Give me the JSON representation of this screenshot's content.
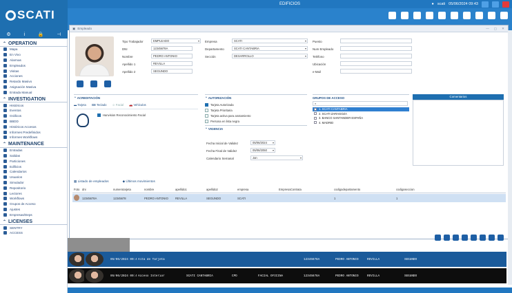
{
  "app": {
    "brand": "SCATI",
    "window_title": "EDIFICIOS",
    "status_user": "scati",
    "status_datetime": "05/06/2024 09:43"
  },
  "sidebar": {
    "sections": [
      {
        "title": "OPERATION",
        "items": [
          "Mapa",
          "En Vivo",
          "Alarmas",
          "Empleados",
          "Visitas",
          "Acciones",
          "Retardo Masivo",
          "Asignación Masiva",
          "Entrada Manual"
        ]
      },
      {
        "title": "INVESTIGATION",
        "items": [
          "Históricos",
          "Eventos",
          "Gráficos",
          "BBDD",
          "Históricos Accesos",
          "Informes Predefinidos",
          "Informes Workflows"
        ]
      },
      {
        "title": "MAINTENANCE",
        "items": [
          "Entradas",
          "Salidas",
          "Particiones",
          "Edificios",
          "Calendarios",
          "Usuarios",
          "Simulador",
          "Repositorio",
          "Lectores",
          "Workflows",
          "Grupos de Acceso",
          "Ajustes",
          "Empresas/Deps"
        ]
      },
      {
        "title": "LICENSES",
        "items": [
          "SENTRY",
          "ACCESS"
        ]
      }
    ]
  },
  "inner": {
    "title": "Empleado"
  },
  "form": {
    "tipo_trabajador": {
      "label": "Tipo Trabajador",
      "value": "EMPLEADO"
    },
    "dni": {
      "label": "DNI",
      "value": "12345678A"
    },
    "nombre": {
      "label": "Nombre",
      "value": "PEDRO ANTONIO"
    },
    "apellido1": {
      "label": "Apellido 1",
      "value": "REVILLA"
    },
    "apellido2": {
      "label": "Apellido 2",
      "value": "SEGUNDO"
    },
    "empresa": {
      "label": "Empresa",
      "value": "SCATI"
    },
    "departamento": {
      "label": "Departamento",
      "value": "SCATI CANTABRIA"
    },
    "seccion": {
      "label": "Sección",
      "value": "DESARROLLO"
    },
    "puesto": {
      "label": "Puesto",
      "value": ""
    },
    "num_empleado": {
      "label": "Num Empleado",
      "value": ""
    },
    "telefono": {
      "label": "Teléfono",
      "value": ""
    },
    "ubicacion": {
      "label": "Ubicación",
      "value": ""
    },
    "email": {
      "label": "e-Mail",
      "value": ""
    }
  },
  "acreditacion": {
    "title": "ACREDITACIÓN",
    "tabs": [
      "Tarjeta",
      "Teclado",
      "Facial",
      "Vehículos"
    ],
    "facial_item": "Hanvision Reconocimiento Facial"
  },
  "autorizacion": {
    "title": "AUTORIZACIÓN",
    "checks": [
      {
        "label": "Tarjeta Autorizada",
        "on": true
      },
      {
        "label": "Tarjeta Prioritaria",
        "on": false
      },
      {
        "label": "Tarjeta activa para anotamiento",
        "on": false
      },
      {
        "label": "Persona en lista negra",
        "on": false
      }
    ]
  },
  "vigencia": {
    "title": "VIGENCIA",
    "inicio_label": "Fecha Inicial de Validez",
    "inicio": "05/06/2024",
    "fin_label": "Fecha Final de Validez",
    "fin": "05/06/2050",
    "cal_label": "Calendario Semanal",
    "cal": "Jan"
  },
  "grupos": {
    "title": "GRUPOS DE ACCESO",
    "items": [
      {
        "label": "1. SCATI CANTABRIA",
        "sel": true
      },
      {
        "label": "2. SCATI ZARAGOZA",
        "sel": false
      },
      {
        "label": "3. BANCO SANTANDER ESPAÑA",
        "sel": false
      },
      {
        "label": "4. MADRID",
        "sel": false
      }
    ]
  },
  "comentarios": {
    "title": "Comentarios"
  },
  "list": {
    "tabs": [
      "Listado de empleados",
      "Últimos movimientos"
    ],
    "headers": [
      "Foto",
      "dni",
      "numerotarjeta",
      "nombre",
      "apellido1",
      "apellido2",
      "empresa",
      "EmpresaContrata",
      "codigodepartamento",
      "codigoseccion"
    ],
    "row": [
      "",
      "12345678A",
      "12345678",
      "PEDRO ANTONIO",
      "REVILLA",
      "SEGUNDO",
      "SCATI",
      "",
      "1",
      "1"
    ]
  },
  "events": [
    {
      "time": "05/06/2024 09:4",
      "event": "Alta de Tarjeta",
      "site": "",
      "unit": "",
      "type": "",
      "dni": "12345678A",
      "name": "PEDRO ANTONIO",
      "ap1": "REVILLA",
      "ap2": "SEGUNDO"
    },
    {
      "time": "05/06/2024 09:4",
      "event": "Acceso Interior",
      "site": "SCATI CANTABRIA",
      "unit": "CPD",
      "type": "FACIAL OFICINA",
      "dni": "12345678A",
      "name": "PEDRO ANTONIO",
      "ap1": "REVILLA",
      "ap2": "SEGUNDO"
    }
  ],
  "colors": {
    "accent": "#1e6fb0",
    "event_row": "#1a5a9a",
    "event_row2": "#0d0d0d"
  }
}
